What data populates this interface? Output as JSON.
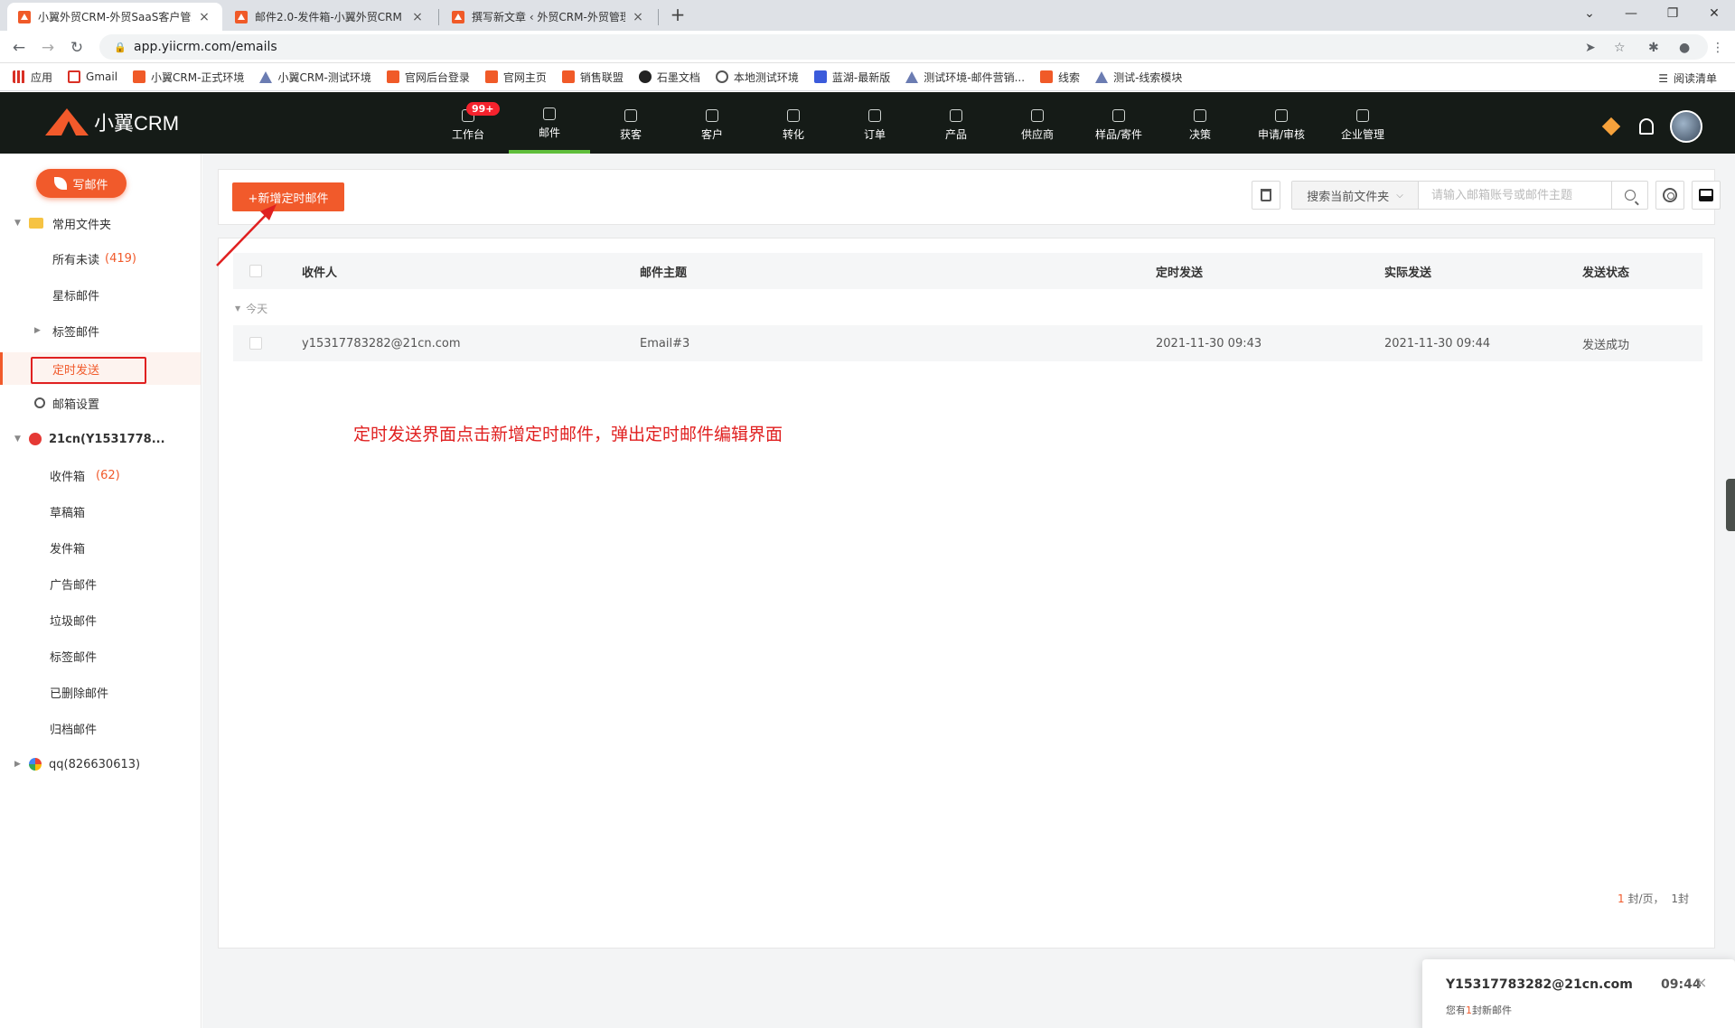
{
  "browser": {
    "tabs": [
      {
        "title": "小翼外贸CRM-外贸SaaS客户管理",
        "active": true
      },
      {
        "title": "邮件2.0-发件箱-小翼外贸CRM",
        "active": false
      },
      {
        "title": "撰写新文章 ‹ 外贸CRM-外贸管理",
        "active": false
      }
    ],
    "tab_close": "×",
    "new_tab": "+",
    "url": "app.yiicrm.com/emails",
    "bookmarks": [
      {
        "label": "应用",
        "icon": "apps-grid-icon"
      },
      {
        "label": "Gmail",
        "icon": "gmail-icon"
      },
      {
        "label": "小翼CRM-正式环境",
        "icon": "xiaoyi-logo-icon"
      },
      {
        "label": "小翼CRM-测试环境",
        "icon": "triangle-logo-icon"
      },
      {
        "label": "官网后台登录",
        "icon": "xiaoyi-logo-icon"
      },
      {
        "label": "官网主页",
        "icon": "xiaoyi-logo-icon"
      },
      {
        "label": "销售联盟",
        "icon": "xiaoyi-logo-icon"
      },
      {
        "label": "石墨文档",
        "icon": "shimo-icon"
      },
      {
        "label": "本地测试环境",
        "icon": "globe-icon"
      },
      {
        "label": "蓝湖-最新版",
        "icon": "lanhu-icon"
      },
      {
        "label": "测试环境-邮件营销...",
        "icon": "triangle-logo-icon"
      },
      {
        "label": "线索",
        "icon": "xiaoyi-logo-icon"
      },
      {
        "label": "测试-线索模块",
        "icon": "triangle-logo-icon"
      }
    ],
    "reading_list": "阅读清单"
  },
  "app": {
    "logo_text": "小翼CRM",
    "nav": [
      {
        "label": "工作台",
        "icon": "dashboard-icon",
        "badge": "99+"
      },
      {
        "label": "邮件",
        "icon": "mail-icon",
        "active": true
      },
      {
        "label": "获客",
        "icon": "acquire-icon"
      },
      {
        "label": "客户",
        "icon": "customer-icon"
      },
      {
        "label": "转化",
        "icon": "convert-icon"
      },
      {
        "label": "订单",
        "icon": "order-icon"
      },
      {
        "label": "产品",
        "icon": "product-icon"
      },
      {
        "label": "供应商",
        "icon": "supplier-icon"
      },
      {
        "label": "样品/寄件",
        "icon": "sample-icon"
      },
      {
        "label": "决策",
        "icon": "decision-icon"
      },
      {
        "label": "申请/审核",
        "icon": "approval-icon"
      },
      {
        "label": "企业管理",
        "icon": "enterprise-icon"
      }
    ],
    "accent_color": "#f15a2b",
    "nav_bg": "#151b17",
    "active_underline": "#5fbe3b"
  },
  "sidebar": {
    "compose_label": "写邮件",
    "common_folder": "常用文件夹",
    "all_unread": "所有未读",
    "all_unread_count": "(419)",
    "starred": "星标邮件",
    "tagged": "标签邮件",
    "scheduled": "定时发送",
    "mail_settings": "邮箱设置",
    "account1": {
      "name": "21cn(Y1531778...",
      "inbox": "收件箱",
      "inbox_count": "(62)",
      "drafts": "草稿箱",
      "sent": "发件箱",
      "ads": "广告邮件",
      "spam": "垃圾邮件",
      "tagged": "标签邮件",
      "deleted": "已删除邮件",
      "archived": "归档邮件"
    },
    "account2": {
      "name": "qq(826630613)"
    }
  },
  "toolbar": {
    "add_scheduled_label": "+新增定时邮件",
    "search_scope": "搜索当前文件夹",
    "search_placeholder": "请输入邮箱账号或邮件主题",
    "search_value": ""
  },
  "table": {
    "headers": [
      "收件人",
      "邮件主题",
      "定时发送",
      "实际发送",
      "发送状态"
    ],
    "group_label": "今天",
    "rows": [
      {
        "recipient": "y15317783282@21cn.com",
        "subject": "Email#3",
        "scheduled_time": "2021-11-30 09:43",
        "actual_time": "2021-11-30 09:44",
        "status": "发送成功"
      }
    ]
  },
  "annotation": "定时发送界面点击新增定时邮件，弹出定时邮件编辑界面",
  "pagination": {
    "per_page": "1",
    "per_page_label": "封/页，",
    "total": "1封"
  },
  "notification": {
    "title": "Y15317783282@21cn.com",
    "time": "09:44",
    "body_prefix": "您有",
    "body_count": "1",
    "body_suffix": "封新邮件",
    "close": "×"
  }
}
